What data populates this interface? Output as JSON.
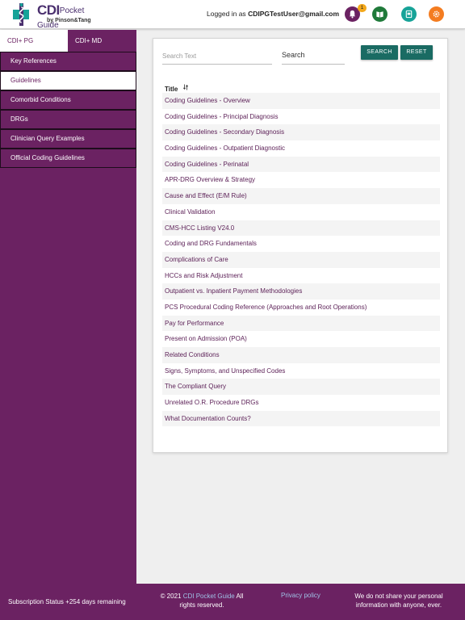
{
  "header": {
    "logo": {
      "brand": "CDI",
      "product": "Pocket Guide",
      "byline": "by Pinson&Tang"
    },
    "logged_in_prefix": "Logged in as",
    "user_email": "CDIPGTestUser@gmail.com",
    "notification_count": "1",
    "icons": [
      "bell-icon",
      "book-icon",
      "tablet-icon",
      "gear-icon"
    ],
    "colors": {
      "bell": "#6b2262",
      "book": "#1f7a3a",
      "tablet": "#17a398",
      "gear": "#f47c20"
    }
  },
  "sidebar": {
    "tabs": [
      {
        "label": "CDI+ PG",
        "active": true
      },
      {
        "label": "CDI+ MD",
        "active": false
      }
    ],
    "items": [
      {
        "label": "Key References",
        "active": false
      },
      {
        "label": "Guidelines",
        "active": true
      },
      {
        "label": "Comorbid Conditions",
        "active": false
      },
      {
        "label": "DRGs",
        "active": false
      },
      {
        "label": "Clinician Query Examples",
        "active": false
      },
      {
        "label": "Official Coding Guidelines",
        "active": false
      }
    ]
  },
  "main": {
    "search": {
      "placeholder": "Search Text",
      "value": "",
      "field_selected": "Search"
    },
    "buttons": {
      "search_label": "SEARCH",
      "reset_label": "RESET"
    },
    "column_title": "Title",
    "rows": [
      "Coding Guidelines - Overview",
      "Coding Guidelines - Principal Diagnosis",
      "Coding Guidelines - Secondary Diagnosis",
      "Coding Guidelines - Outpatient Diagnostic",
      "Coding Guidelines - Perinatal",
      "APR-DRG Overview & Strategy",
      "Cause and Effect (E/M Rule)",
      "Clinical Validation",
      "CMS-HCC Listing V24.0",
      "Coding and DRG Fundamentals",
      "Complications of Care",
      "HCCs and Risk Adjustment",
      "Outpatient vs. Inpatient Payment Methodologies",
      "PCS Procedural Coding Reference (Approaches and Root Operations)",
      "Pay for Performance",
      "Present on Admission (POA)",
      "Related Conditions",
      "Signs, Symptoms, and Unspecified Codes",
      "The Compliant Query",
      "Unrelated O.R. Procedure DRGs",
      "What Documentation Counts?"
    ]
  },
  "footer": {
    "subscription": "Subscription Status +254 days remaining",
    "copyright_prefix": "© 2021",
    "copyright_link": "CDI Pocket Guide",
    "copyright_suffix": "All rights reserved.",
    "privacy_link": "Privacy policy",
    "share_notice": "We do not share your personal information with anyone, ever."
  },
  "colors": {
    "brand_purple": "#6b2262",
    "button_teal": "#1a6b63",
    "link_blue": "#9fc1e6"
  }
}
